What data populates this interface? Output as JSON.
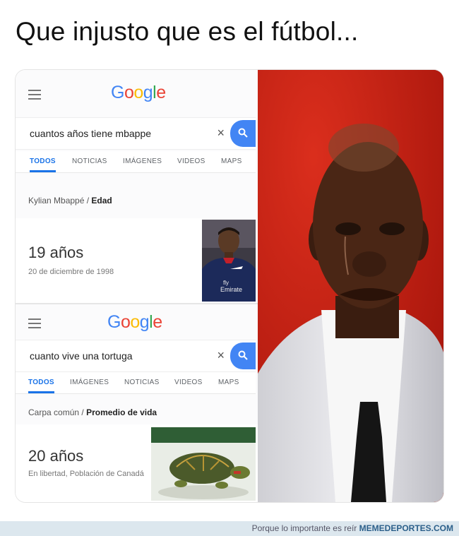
{
  "caption": "Que injusto que es el fútbol...",
  "colors": {
    "google_blue": "#4285f4",
    "google_red": "#ea4335",
    "google_yellow": "#fbbc05",
    "google_green": "#34a853",
    "meme_bg": "#c71f12"
  },
  "search1": {
    "logo": "Google",
    "query": "cuantos años tiene mbappe",
    "clear_icon": "×",
    "tabs": [
      "TODOS",
      "NOTICIAS",
      "IMÁGENES",
      "VIDEOS",
      "MAPS"
    ],
    "crumb_subject": "Kylian Mbappé",
    "crumb_sep": "/",
    "crumb_topic": "Edad",
    "answer": "19 años",
    "detail": "20 de diciembre de 1998",
    "jersey_text_1": "fly",
    "jersey_text_2": "Emirate"
  },
  "search2": {
    "logo": "Google",
    "query": "cuanto vive una tortuga",
    "clear_icon": "×",
    "tabs": [
      "TODOS",
      "IMÁGENES",
      "NOTICIAS",
      "VIDEOS",
      "MAPS"
    ],
    "crumb_subject": "Carpa común",
    "crumb_sep": "/",
    "crumb_topic": "Promedio de vida",
    "answer": "20 años",
    "detail": "En libertad, Población de Canadá"
  },
  "footer": {
    "tagline": "Porque lo importante es reír",
    "brand": "MEMEDEPORTES.COM"
  }
}
